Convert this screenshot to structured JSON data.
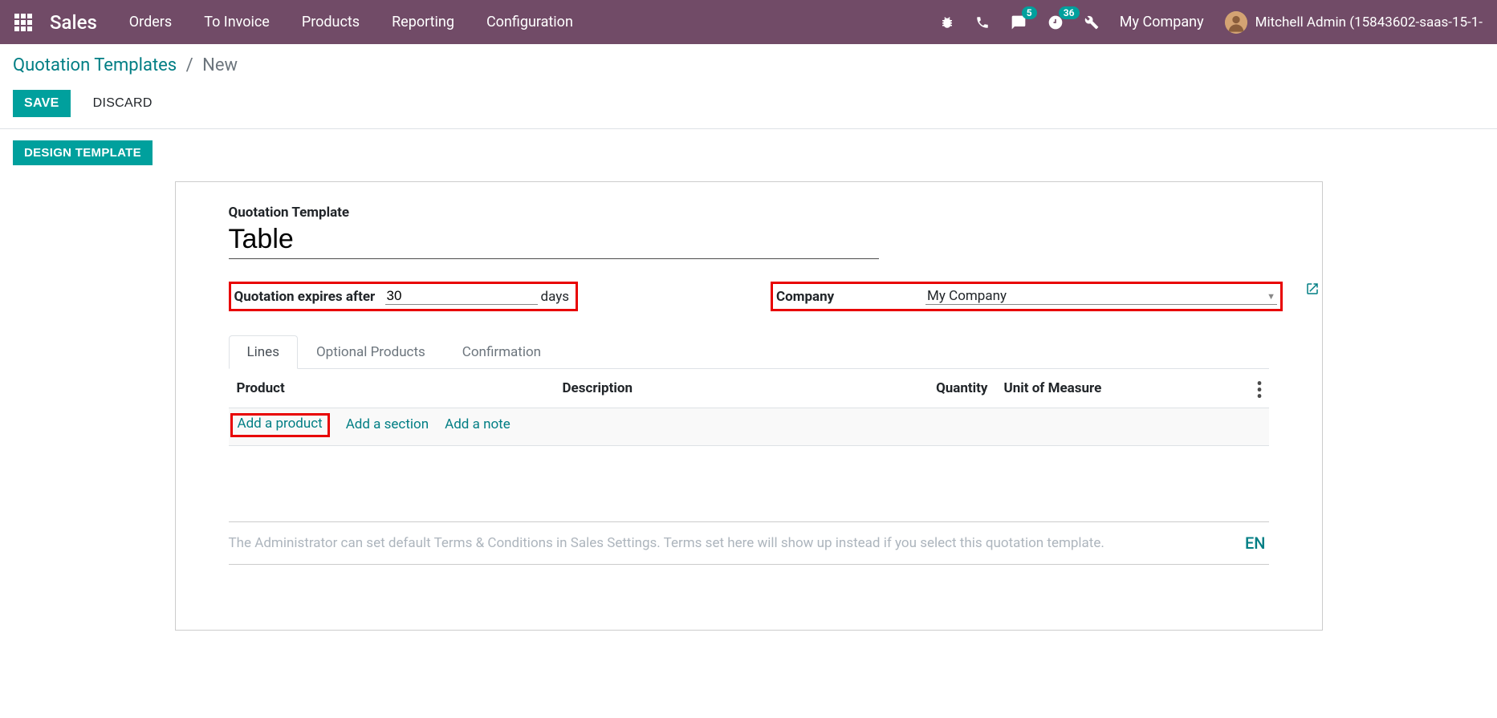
{
  "navbar": {
    "brand": "Sales",
    "menu": [
      "Orders",
      "To Invoice",
      "Products",
      "Reporting",
      "Configuration"
    ],
    "messages_badge": "5",
    "activities_badge": "36",
    "company": "My Company",
    "user": "Mitchell Admin (15843602-saas-15-1-"
  },
  "breadcrumb": {
    "parent": "Quotation Templates",
    "current": "New"
  },
  "buttons": {
    "save": "SAVE",
    "discard": "DISCARD",
    "design": "DESIGN TEMPLATE"
  },
  "form": {
    "name_label": "Quotation Template",
    "name_value": "Table",
    "expires_label": "Quotation expires after",
    "expires_value": "30",
    "expires_suffix": "days",
    "company_label": "Company",
    "company_value": "My Company"
  },
  "tabs": [
    "Lines",
    "Optional Products",
    "Confirmation"
  ],
  "lines": {
    "col_product": "Product",
    "col_description": "Description",
    "col_quantity": "Quantity",
    "col_uom": "Unit of Measure",
    "add_product": "Add a product",
    "add_section": "Add a section",
    "add_note": "Add a note"
  },
  "terms_placeholder": "The Administrator can set default Terms & Conditions in Sales Settings. Terms set here will show up instead if you select this quotation template.",
  "lang": "EN"
}
